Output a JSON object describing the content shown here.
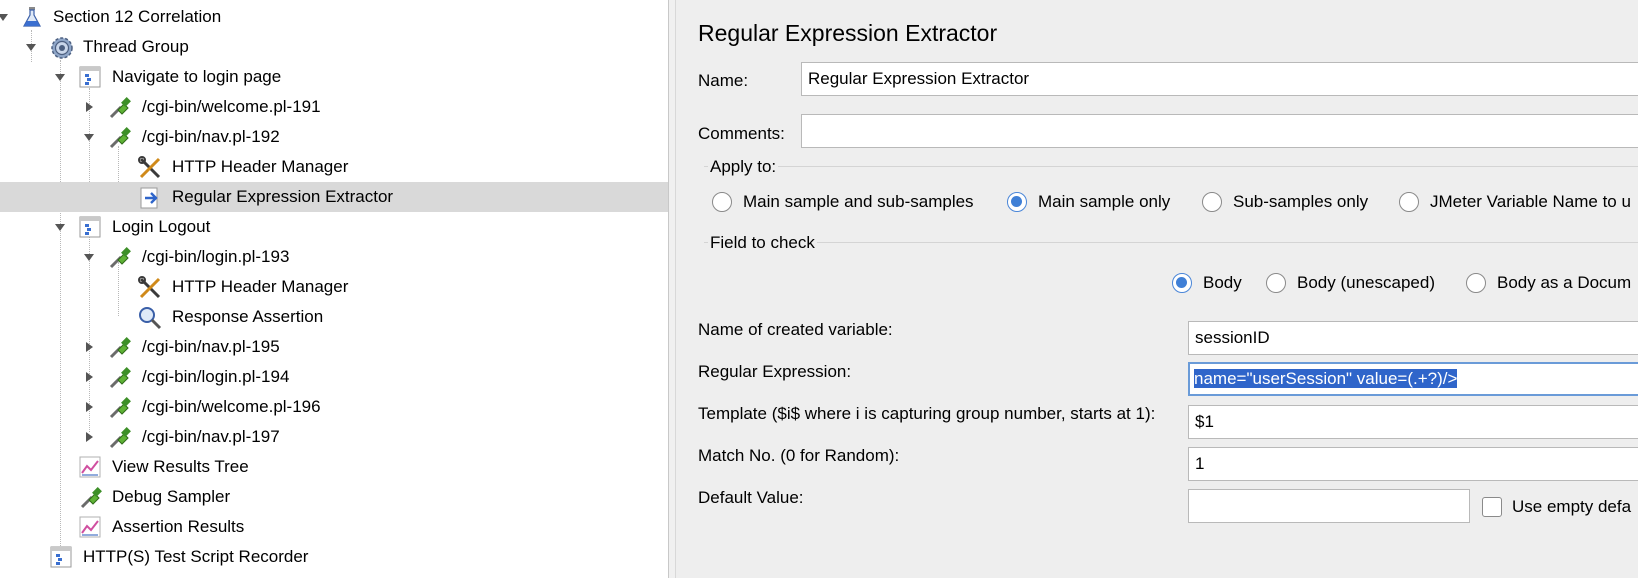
{
  "tree": {
    "items": [
      {
        "label": "Section 12 Correlation",
        "icon": "test-plan-flask-icon"
      },
      {
        "label": "Thread Group",
        "icon": "thread-group-gear-icon"
      },
      {
        "label": "Navigate to login page",
        "icon": "transaction-controller-icon"
      },
      {
        "label": "/cgi-bin/welcome.pl-191",
        "icon": "http-sampler-pipette-icon"
      },
      {
        "label": "/cgi-bin/nav.pl-192",
        "icon": "http-sampler-pipette-icon"
      },
      {
        "label": "HTTP Header Manager",
        "icon": "header-manager-tools-icon"
      },
      {
        "label": "Regular Expression Extractor",
        "icon": "regex-extractor-icon"
      },
      {
        "label": "Login Logout",
        "icon": "transaction-controller-icon"
      },
      {
        "label": "/cgi-bin/login.pl-193",
        "icon": "http-sampler-pipette-icon"
      },
      {
        "label": "HTTP Header Manager",
        "icon": "header-manager-tools-icon"
      },
      {
        "label": "Response Assertion",
        "icon": "assertion-magnifier-icon"
      },
      {
        "label": "/cgi-bin/nav.pl-195",
        "icon": "http-sampler-pipette-icon"
      },
      {
        "label": "/cgi-bin/login.pl-194",
        "icon": "http-sampler-pipette-icon"
      },
      {
        "label": "/cgi-bin/welcome.pl-196",
        "icon": "http-sampler-pipette-icon"
      },
      {
        "label": "/cgi-bin/nav.pl-197",
        "icon": "http-sampler-pipette-icon"
      },
      {
        "label": "View Results Tree",
        "icon": "listener-graph-icon"
      },
      {
        "label": "Debug Sampler",
        "icon": "http-sampler-pipette-icon"
      },
      {
        "label": "Assertion Results",
        "icon": "listener-graph-icon"
      },
      {
        "label": "HTTP(S) Test Script Recorder",
        "icon": "recorder-icon"
      }
    ]
  },
  "panel": {
    "title": "Regular Expression Extractor",
    "name_label": "Name:",
    "name_value": "Regular Expression Extractor",
    "comments_label": "Comments:",
    "comments_value": "",
    "apply_to": {
      "title": "Apply to:",
      "options": [
        "Main sample and sub-samples",
        "Main sample only",
        "Sub-samples only",
        "JMeter Variable Name to u"
      ],
      "selected": "Main sample only"
    },
    "field_to_check": {
      "title": "Field to check",
      "options": [
        "Body",
        "Body (unescaped)",
        "Body as a Docum"
      ],
      "selected": "Body"
    },
    "variable_label": "Name of created variable:",
    "variable_value": "sessionID",
    "regex_label": "Regular Expression:",
    "regex_value": "name=\"userSession\" value=(.+?)/>",
    "template_label": "Template ($i$ where i is capturing group number, starts at 1):",
    "template_value": "$1",
    "match_label": "Match No. (0 for Random):",
    "match_value": "1",
    "default_label": "Default Value:",
    "default_value": "",
    "use_empty_label": "Use empty defa"
  },
  "colors": {
    "selection_row": "#d9d9d9",
    "panel_bg": "#eeeeee",
    "text_selection": "#2f65ca",
    "radio_accent": "#3f7fd6"
  }
}
